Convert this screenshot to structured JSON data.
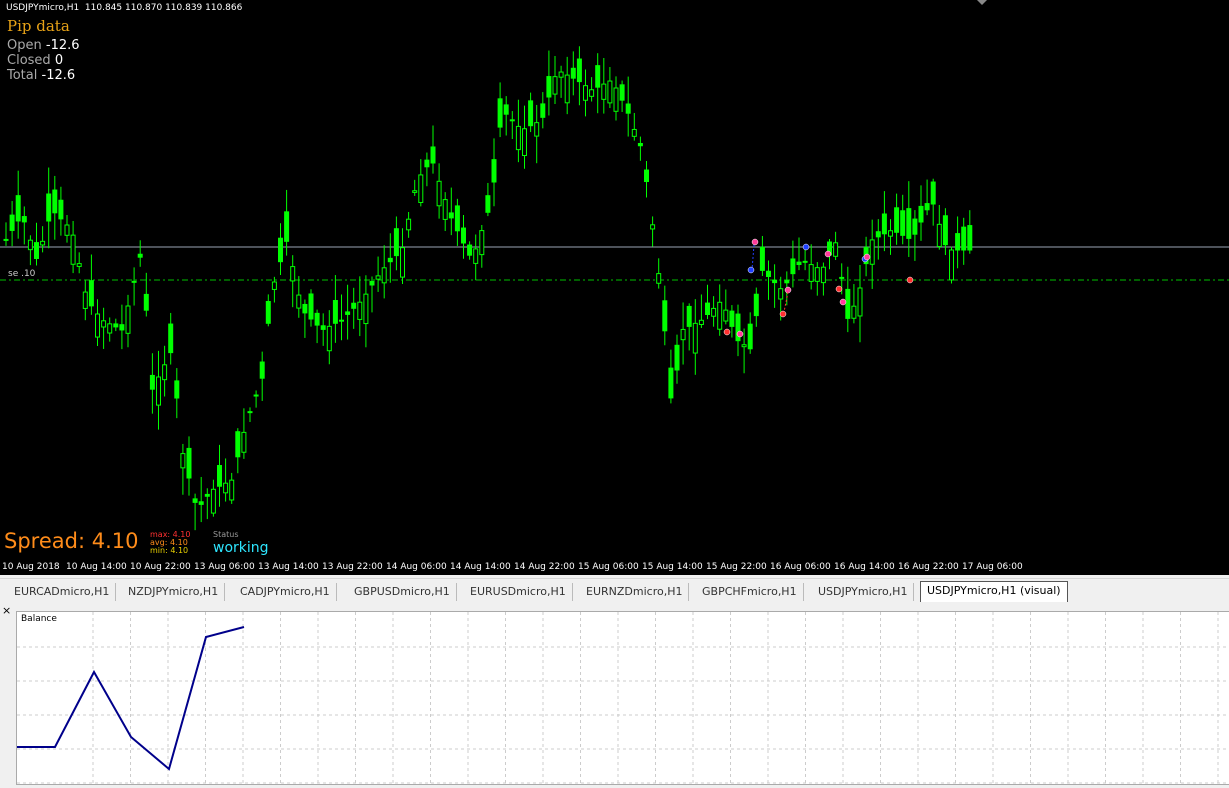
{
  "chart": {
    "header": "USDJPYmicro,H1  110.845 110.870 110.839 110.866",
    "line_label": "se   .10"
  },
  "pip_data": {
    "title": "Pip data",
    "open_label": "Open",
    "open_value": "-12.6",
    "closed_label": "Closed",
    "closed_value": "0",
    "total_label": "Total",
    "total_value": "-12.6"
  },
  "spread": {
    "label": "Spread: 4.10",
    "max_label": "max:",
    "max_value": "4.10",
    "avg_label": "avg:",
    "avg_value": "4.10",
    "min_label": "min:",
    "min_value": "4.10"
  },
  "status": {
    "label": "Status",
    "value": "working"
  },
  "time_axis": [
    "10 Aug 2018",
    "10 Aug 14:00",
    "10 Aug 22:00",
    "13 Aug 06:00",
    "13 Aug 14:00",
    "13 Aug 22:00",
    "14 Aug 06:00",
    "14 Aug 14:00",
    "14 Aug 22:00",
    "15 Aug 06:00",
    "15 Aug 14:00",
    "15 Aug 22:00",
    "16 Aug 06:00",
    "16 Aug 14:00",
    "16 Aug 22:00",
    "17 Aug 06:00"
  ],
  "tabs": [
    "EURCADmicro,H1",
    "NZDJPYmicro,H1",
    "CADJPYmicro,H1",
    "GBPUSDmicro,H1",
    "EURUSDmicro,H1",
    "EURNZDmicro,H1",
    "GBPCHFmicro,H1",
    "USDJPYmicro,H1",
    "USDJPYmicro,H1 (visual)"
  ],
  "active_tab": 8,
  "balance": {
    "title": "Balance"
  },
  "colors": {
    "candle": "#00ff00",
    "background": "#000000",
    "balance_line": "#00008b",
    "spread": "#ff8c1a",
    "status": "#2ee6ff",
    "max": "#ff3030",
    "avg": "#ff8c1a",
    "min": "#e8d000"
  }
}
